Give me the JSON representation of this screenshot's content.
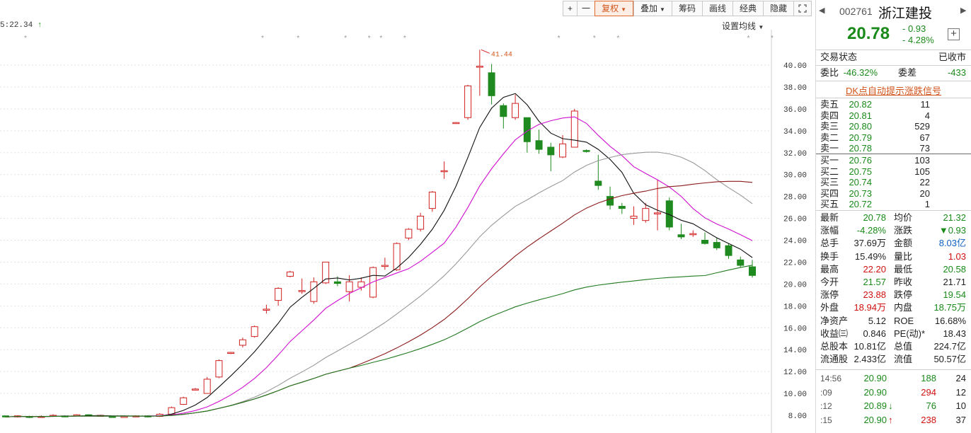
{
  "toolbar": {
    "plus": "+",
    "minus": "一",
    "fuquan": "复权",
    "diejia": "叠加",
    "chouma": "筹码",
    "huaxian": "画线",
    "jingdian": "经典",
    "yincang": "隐藏",
    "expand_icon": "expand-icon"
  },
  "chart": {
    "timestamp": "5:22.34",
    "settings_label": "设置均线",
    "high_marker": "41.44",
    "y_axis_labels": [
      "40.00",
      "38.00",
      "36.00",
      "34.00",
      "32.00",
      "30.00",
      "28.00",
      "26.00",
      "24.00",
      "22.00",
      "20.00",
      "18.00",
      "16.00",
      "14.00",
      "12.00",
      "10.00",
      "8.00"
    ],
    "colors": {
      "up": "#d22222",
      "down": "#1f8a1f",
      "ma5": "#111111",
      "ma10": "#d010d0",
      "ma20": "#999999",
      "ma30": "#8b1a1a",
      "ma60": "#1f7a1f",
      "grid": "#e2e2e2"
    }
  },
  "quote": {
    "code": "002761",
    "name": "浙江建投",
    "price": "20.78",
    "change": "- 0.93",
    "change_pct": "- 4.28%",
    "status_label": "交易状态",
    "status_value": "已收市",
    "weibi_label": "委比",
    "weibi_value": "-46.32%",
    "weicha_label": "委差",
    "weicha_value": "-433",
    "dk_link": "DK点自动提示涨跌信号",
    "asks": [
      {
        "label": "卖五",
        "price": "20.82",
        "vol": "11"
      },
      {
        "label": "卖四",
        "price": "20.81",
        "vol": "4"
      },
      {
        "label": "卖三",
        "price": "20.80",
        "vol": "529"
      },
      {
        "label": "卖二",
        "price": "20.79",
        "vol": "67"
      },
      {
        "label": "卖一",
        "price": "20.78",
        "vol": "73"
      }
    ],
    "bids": [
      {
        "label": "买一",
        "price": "20.76",
        "vol": "103"
      },
      {
        "label": "买二",
        "price": "20.75",
        "vol": "105"
      },
      {
        "label": "买三",
        "price": "20.74",
        "vol": "22"
      },
      {
        "label": "买四",
        "price": "20.73",
        "vol": "20"
      },
      {
        "label": "买五",
        "price": "20.72",
        "vol": "1"
      }
    ],
    "stats": [
      {
        "l1": "最新",
        "v1": "20.78",
        "c1": "green",
        "l2": "均价",
        "v2": "21.32",
        "c2": "green"
      },
      {
        "l1": "涨幅",
        "v1": "-4.28%",
        "c1": "green",
        "l2": "涨跌",
        "v2": "▼0.93",
        "c2": "green"
      },
      {
        "l1": "总手",
        "v1": "37.69万",
        "c1": "",
        "l2": "金额",
        "v2": "8.03亿",
        "c2": "blue"
      },
      {
        "l1": "换手",
        "v1": "15.49%",
        "c1": "",
        "l2": "量比",
        "v2": "1.03",
        "c2": "red"
      },
      {
        "l1": "最高",
        "v1": "22.20",
        "c1": "red",
        "l2": "最低",
        "v2": "20.58",
        "c2": "green"
      },
      {
        "l1": "今开",
        "v1": "21.57",
        "c1": "green",
        "l2": "昨收",
        "v2": "21.71",
        "c2": ""
      },
      {
        "l1": "涨停",
        "v1": "23.88",
        "c1": "red",
        "l2": "跌停",
        "v2": "19.54",
        "c2": "green"
      },
      {
        "l1": "外盘",
        "v1": "18.94万",
        "c1": "red",
        "l2": "内盘",
        "v2": "18.75万",
        "c2": "green"
      },
      {
        "l1": "净资产",
        "v1": "5.12",
        "c1": "",
        "l2": "ROE",
        "v2": "16.68%",
        "c2": ""
      },
      {
        "l1": "收益㈢",
        "v1": "0.846",
        "c1": "",
        "l2": "PE(动)*",
        "v2": "18.43",
        "c2": ""
      },
      {
        "l1": "总股本",
        "v1": "10.81亿",
        "c1": "",
        "l2": "总值",
        "v2": "224.7亿",
        "c2": ""
      },
      {
        "l1": "流通股",
        "v1": "2.433亿",
        "c1": "",
        "l2": "流值",
        "v2": "50.57亿",
        "c2": ""
      }
    ],
    "ticks": [
      {
        "time": "14:56",
        "price": "20.90",
        "arrow": "",
        "vol": "188",
        "vc": "green",
        "n": "24"
      },
      {
        "time": ":09",
        "price": "20.90",
        "arrow": "",
        "vol": "294",
        "vc": "red",
        "n": "12"
      },
      {
        "time": ":12",
        "price": "20.89",
        "arrow": "↓",
        "vol": "76",
        "vc": "green",
        "n": "10"
      },
      {
        "time": ":15",
        "price": "20.90",
        "arrow": "↑",
        "vol": "238",
        "vc": "red",
        "n": "37"
      }
    ]
  },
  "chart_data": {
    "type": "candlestick",
    "ylim": [
      7,
      42
    ],
    "y_ticks": [
      8,
      10,
      12,
      14,
      16,
      18,
      20,
      22,
      24,
      26,
      28,
      30,
      32,
      34,
      36,
      38,
      40
    ],
    "candles": [
      [
        7.95,
        7.85,
        8.0,
        7.8
      ],
      [
        7.9,
        7.95,
        8.0,
        7.8
      ],
      [
        7.9,
        7.85,
        7.95,
        7.75
      ],
      [
        7.85,
        7.9,
        8.0,
        7.8
      ],
      [
        7.9,
        8.0,
        8.1,
        7.85
      ],
      [
        7.95,
        7.9,
        8.0,
        7.85
      ],
      [
        7.95,
        8.05,
        8.1,
        7.9
      ],
      [
        8.05,
        7.95,
        8.1,
        7.9
      ],
      [
        7.95,
        8.0,
        8.05,
        7.9
      ],
      [
        7.9,
        7.85,
        7.95,
        7.8
      ],
      [
        7.85,
        7.9,
        7.95,
        7.8
      ],
      [
        7.9,
        7.95,
        8.0,
        7.85
      ],
      [
        7.95,
        7.9,
        8.0,
        7.8
      ],
      [
        7.9,
        8.1,
        8.2,
        7.85
      ],
      [
        8.1,
        8.7,
        8.8,
        8.05
      ],
      [
        9.0,
        9.6,
        9.7,
        8.95
      ],
      [
        10.35,
        10.4,
        10.5,
        10.3
      ],
      [
        10.0,
        11.3,
        11.5,
        10.0
      ],
      [
        11.5,
        13.0,
        13.1,
        11.4
      ],
      [
        13.7,
        13.75,
        13.8,
        13.6
      ],
      [
        14.4,
        14.9,
        15.1,
        14.2
      ],
      [
        15.2,
        16.1,
        16.2,
        15.1
      ],
      [
        17.6,
        17.7,
        18.1,
        17.3
      ],
      [
        18.5,
        19.6,
        19.7,
        18.0
      ],
      [
        20.7,
        21.1,
        21.2,
        20.6
      ],
      [
        19.3,
        19.4,
        20.5,
        19.1
      ],
      [
        18.4,
        20.2,
        20.6,
        18.2
      ],
      [
        20.1,
        22.0,
        22.0,
        20.0
      ],
      [
        20.2,
        20.05,
        20.7,
        19.8
      ],
      [
        19.3,
        20.2,
        20.8,
        18.4
      ],
      [
        19.7,
        20.2,
        20.6,
        19.4
      ],
      [
        18.8,
        21.5,
        21.6,
        18.7
      ],
      [
        21.6,
        21.7,
        22.4,
        21.3
      ],
      [
        21.3,
        23.7,
        23.8,
        21.2
      ],
      [
        24.2,
        25.0,
        25.1,
        24.0
      ],
      [
        25.0,
        26.2,
        26.5,
        24.8
      ],
      [
        26.9,
        28.4,
        28.5,
        26.6
      ],
      [
        30.3,
        30.35,
        31.2,
        29.6
      ],
      [
        34.7,
        34.75,
        34.8,
        34.7
      ],
      [
        35.2,
        38.1,
        38.2,
        35.0
      ],
      [
        39.8,
        39.9,
        41.4,
        37.2
      ],
      [
        39.3,
        37.2,
        40.1,
        36.4
      ],
      [
        36.3,
        35.3,
        36.5,
        34.2
      ],
      [
        35.2,
        36.5,
        37.3,
        35.0
      ],
      [
        35.2,
        33.0,
        35.2,
        32.0
      ],
      [
        33.1,
        32.3,
        34.1,
        31.9
      ],
      [
        32.5,
        31.8,
        32.9,
        30.3
      ],
      [
        31.6,
        32.8,
        33.6,
        31.5
      ],
      [
        32.5,
        35.8,
        36.0,
        32.5
      ],
      [
        32.2,
        32.1,
        32.3,
        32.0
      ],
      [
        29.4,
        29.0,
        31.8,
        28.6
      ],
      [
        28.0,
        27.2,
        28.9,
        26.8
      ],
      [
        27.1,
        26.9,
        27.4,
        26.4
      ],
      [
        26.0,
        26.2,
        27.1,
        25.4
      ],
      [
        25.8,
        26.9,
        27.4,
        25.6
      ],
      [
        26.4,
        26.5,
        29.5,
        24.9
      ],
      [
        27.6,
        25.2,
        27.9,
        24.9
      ],
      [
        24.5,
        24.3,
        25.5,
        24.1
      ],
      [
        24.5,
        24.6,
        24.9,
        24.3
      ],
      [
        24.0,
        23.7,
        24.7,
        23.6
      ],
      [
        23.8,
        23.3,
        24.2,
        23.1
      ],
      [
        23.5,
        22.6,
        23.7,
        22.3
      ],
      [
        22.2,
        21.7,
        22.5,
        21.5
      ],
      [
        21.57,
        20.78,
        22.2,
        20.58
      ]
    ],
    "high_label": "41.44"
  }
}
